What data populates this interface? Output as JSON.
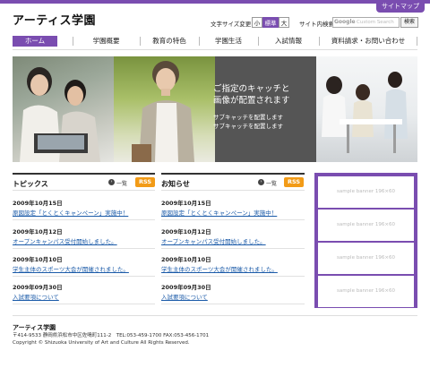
{
  "header": {
    "logo": "アーティス学園",
    "sitemap_label": "サイトマップ",
    "font_size": {
      "label": "文字サイズ変更",
      "small": "小",
      "medium": "標準",
      "large": "大"
    },
    "search": {
      "label": "サイト内検索",
      "google_label": "Google",
      "placeholder": "Custom Search",
      "button": "検索"
    }
  },
  "nav": [
    {
      "label": "ホーム",
      "active": true
    },
    {
      "label": "学園概要",
      "active": false
    },
    {
      "label": "教育の特色",
      "active": false
    },
    {
      "label": "学園生活",
      "active": false
    },
    {
      "label": "入試情報",
      "active": false
    },
    {
      "label": "資料請求・お問い合わせ",
      "active": false
    }
  ],
  "hero": {
    "catch_main_line1": "ご指定のキャッチと",
    "catch_main_line2": "画像が配置されます",
    "catch_sub_line1": "サブキャッチを配置します",
    "catch_sub_line2": "サブキャッチを配置します"
  },
  "topics": {
    "title": "トピックス",
    "list_link": "一覧",
    "rss": "RSS",
    "items": [
      {
        "date": "2009年10月15日",
        "text": "原図設定「とくとくキャンペーン」実施中！"
      },
      {
        "date": "2009年10月12日",
        "text": "オープンキャンパス受付開始しました。"
      },
      {
        "date": "2009年10月10日",
        "text": "学生主体のスポーツ大会が開催されました。"
      },
      {
        "date": "2009年09月30日",
        "text": "入試要項について"
      }
    ]
  },
  "news": {
    "title": "お知らせ",
    "list_link": "一覧",
    "rss": "RSS",
    "items": [
      {
        "date": "2009年10月15日",
        "text": "原図設定「とくとくキャンペーン」実施中！"
      },
      {
        "date": "2009年10月12日",
        "text": "オープンキャンパス受付開始しました。"
      },
      {
        "date": "2009年10月10日",
        "text": "学生主体のスポーツ大会が開催されました。"
      },
      {
        "date": "2009年09月30日",
        "text": "入試要項について"
      }
    ]
  },
  "banners": [
    "sample banner 196×60",
    "sample banner 196×60",
    "sample banner 196×60",
    "sample banner 196×60"
  ],
  "footer": {
    "name": "アーティス学園",
    "address": "〒414-9533 静岡県浜松市中区佐鳴町111-2　TEL:053-459-1700  FAX:053-456-1701",
    "copyright": "Copyright © Shizuoka University of Art and Culture All Rights Reserved."
  },
  "colors": {
    "accent": "#7a4db0",
    "rss": "#f29b17",
    "link": "#1a5aa8",
    "catch_panel": "#555555"
  }
}
